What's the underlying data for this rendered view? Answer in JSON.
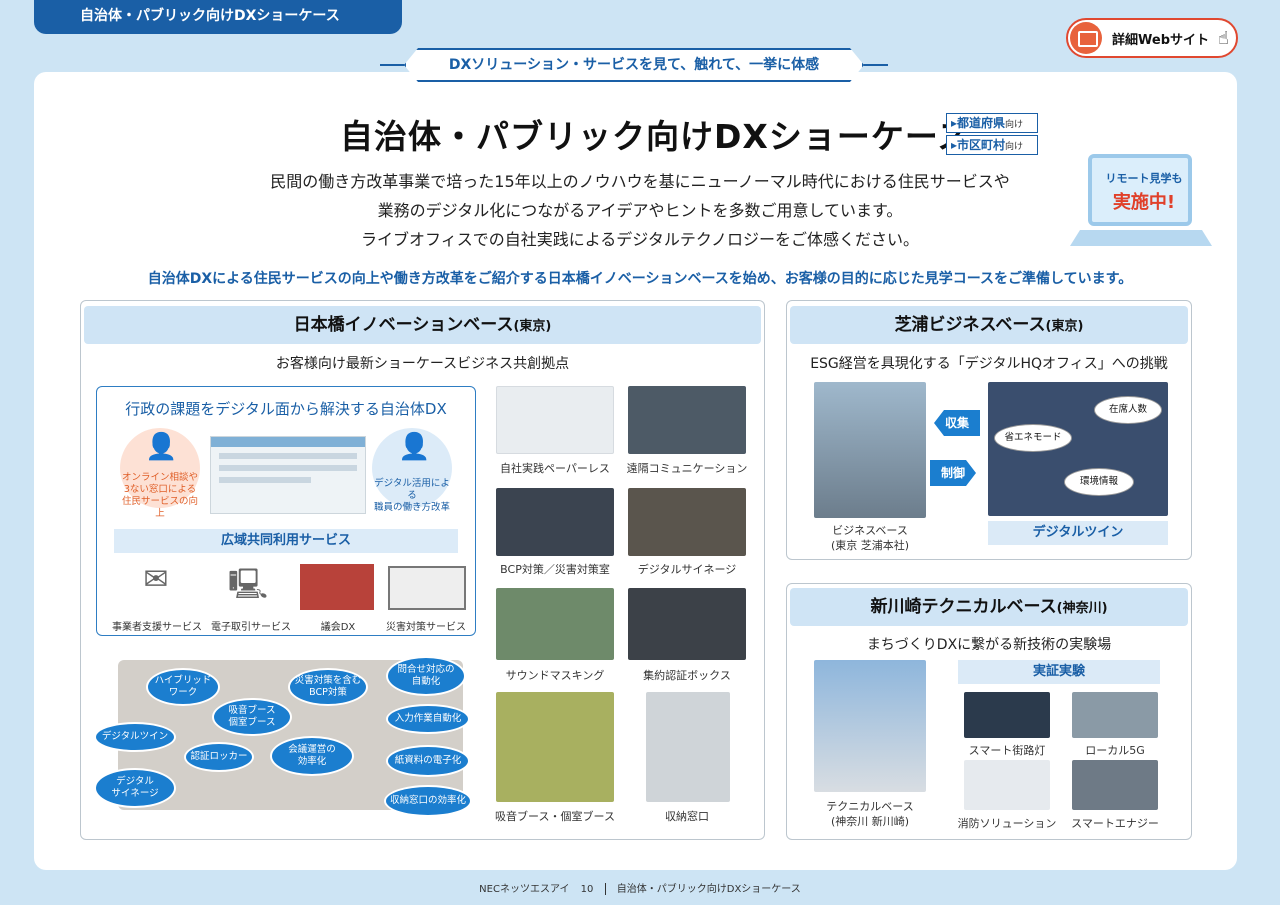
{
  "header": {
    "tab_title": "自治体・パブリック向けDXショーケース",
    "web_button": "詳細Webサイト",
    "ribbon": "DXソリューション・サービスを見て、触れて、一挙に体感"
  },
  "main": {
    "title": "自治体・パブリック向けDXショーケース",
    "tag1": "都道府県",
    "tag1_suffix": "向け",
    "tag2": "市区町村",
    "tag2_suffix": "向け",
    "lead1": "民間の働き方改革事業で培った15年以上のノウハウを基にニューノーマル時代における住民サービスや",
    "lead2": "業務のデジタル化につながるアイデアやヒントを多数ご用意しています。",
    "lead3": "ライブオフィスでの自社実践によるデジタルテクノロジーをご体感ください。",
    "remote1": "リモート見学も",
    "remote2": "実施中!",
    "subhead": "自治体DXによる住民サービスの向上や働き方改革をご紹介する日本橋イノベーションベースを始め、お客様の目的に応じた見学コースをご準備しています。"
  },
  "nihonbashi": {
    "title": "日本橋イノベーションベース",
    "region": "(東京)",
    "subtitle": "お客様向け最新ショーケースビジネス共創拠点",
    "gx_title": "行政の課題をデジタル面から解決する自治体DX",
    "circle_left": [
      "オンライン相談や",
      "3ない窓口による",
      "住民サービスの向上"
    ],
    "circle_right": [
      "デジタル活用による",
      "職員の働き方改革"
    ],
    "band": "広域共同利用サービス",
    "services": [
      "事業者支援サービス",
      "電子取引サービス",
      "議会DX",
      "災害対策サービス"
    ],
    "bubbles": [
      "ハイブリッド\nワーク",
      "災害対策を含む\nBCP対策",
      "問合せ対応の\n自動化",
      "吸音ブース\n個室ブース",
      "入力作業自動化",
      "デジタルツイン",
      "認証ロッカー",
      "会議運営の\n効率化",
      "紙資料の電子化",
      "デジタル\nサイネージ",
      "収納窓口の効率化"
    ],
    "photos": [
      "自社実践ペーパーレス",
      "遠隔コミュニケーション",
      "BCP対策／災害対策室",
      "デジタルサイネージ",
      "サウンドマスキング",
      "集約認証ボックス",
      "吸音ブース・個室ブース",
      "収納窓口"
    ]
  },
  "shibaura": {
    "title": "芝浦ビジネスベース",
    "region": "(東京)",
    "subtitle": "ESG経営を具現化する「デジタルHQオフィス」への挑戦",
    "arrow1": "収集",
    "arrow2": "制御",
    "twin_tags": [
      "在席人数",
      "省エネモード",
      "環境情報"
    ],
    "cap_left1": "ビジネスベース",
    "cap_left2": "(東京 芝浦本社)",
    "twin_label": "デジタルツイン"
  },
  "shinkawasaki": {
    "title": "新川崎テクニカルベース",
    "region": "(神奈川)",
    "subtitle": "まちづくりDXに繋がる新技術の実験場",
    "cap1": "テクニカルベース",
    "cap2": "(神奈川 新川崎)",
    "band": "実証実験",
    "items": [
      "スマート街路灯",
      "ローカル5G",
      "消防ソリューション",
      "スマートエナジー"
    ]
  },
  "footer": {
    "company": "NECネッツエスアイ",
    "page": "10",
    "section": "自治体・パブリック向けDXショーケース"
  }
}
